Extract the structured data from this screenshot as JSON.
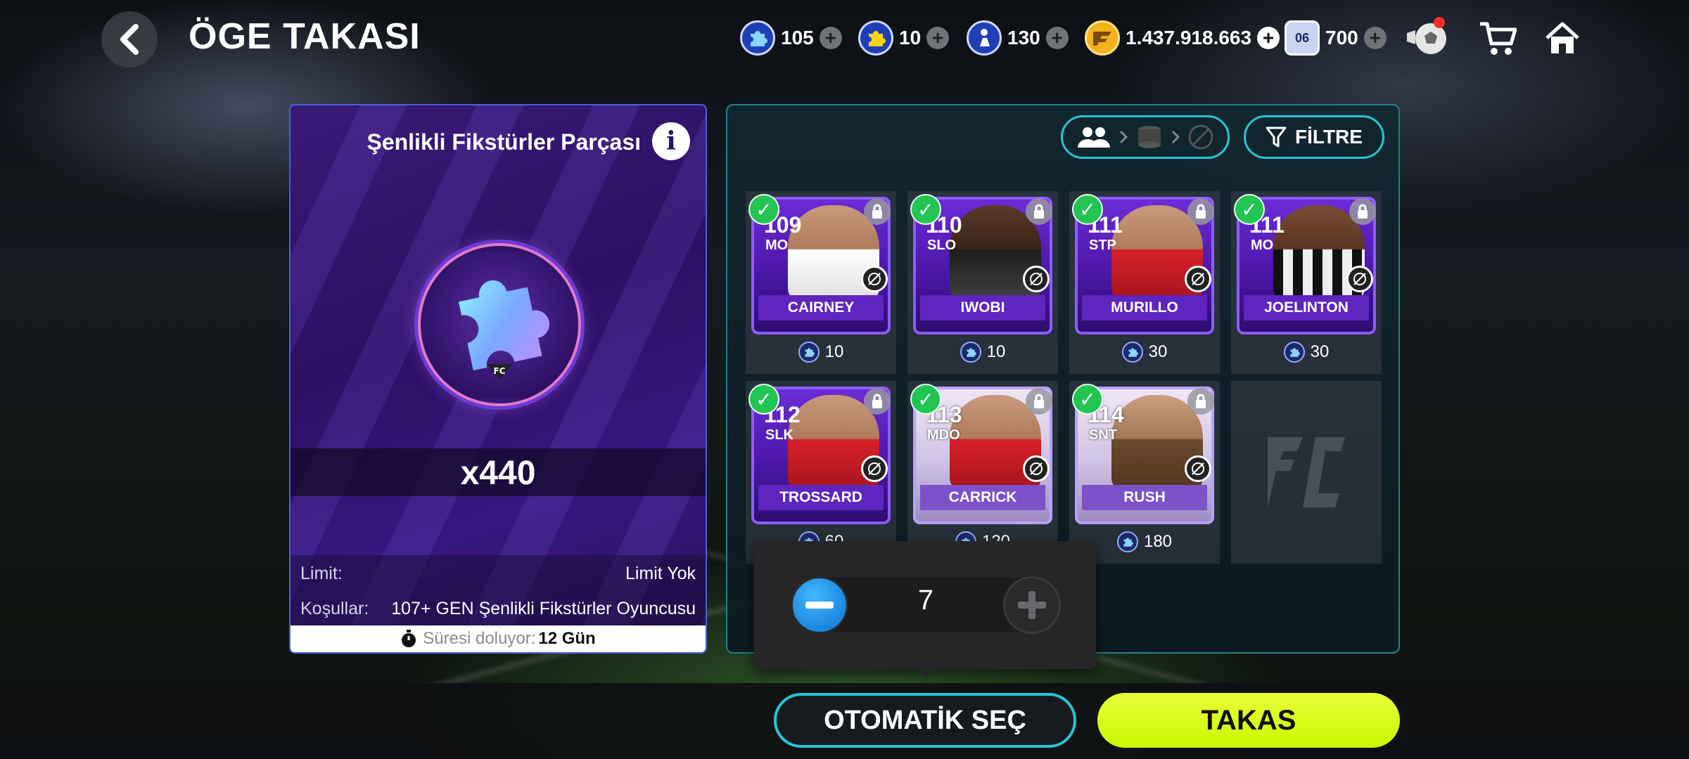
{
  "header": {
    "title": "ÖGE TAKASI",
    "currencies": [
      {
        "icon": "blue-puzzle-icon",
        "value": "105",
        "add": "+"
      },
      {
        "icon": "gold-puzzle-icon",
        "value": "10",
        "add": "+"
      },
      {
        "icon": "player-token-icon",
        "value": "130",
        "add": "+"
      },
      {
        "icon": "fc-coin-icon",
        "value": "1.437.918.663",
        "add": "+"
      },
      {
        "icon": "fc-points-badge-icon",
        "badge": "06",
        "value": "700",
        "add": "+"
      }
    ]
  },
  "item_panel": {
    "title": "Şenlikli Fikstürler Parçası",
    "info_glyph": "i",
    "count": "x440",
    "limit_label": "Limit:",
    "limit_value": "Limit Yok",
    "conditions_label": "Koşullar:",
    "conditions_value": "107+ GEN Şenlikli Fikstürler Oyuncusu",
    "expiry_label": "Süresi doluyor:",
    "expiry_value": "12 Gün"
  },
  "filter": {
    "label": "FİLTRE"
  },
  "players": [
    {
      "rating": "109",
      "position": "MO",
      "name": "CAIRNEY",
      "cost": "10",
      "selected": true
    },
    {
      "rating": "110",
      "position": "SLO",
      "name": "IWOBI",
      "cost": "10",
      "selected": true
    },
    {
      "rating": "111",
      "position": "STP",
      "name": "MURILLO",
      "cost": "30",
      "selected": true
    },
    {
      "rating": "111",
      "position": "MO",
      "name": "JOELINTON",
      "cost": "30",
      "selected": true
    },
    {
      "rating": "112",
      "position": "SLK",
      "name": "TROSSARD",
      "cost": "60",
      "selected": true
    },
    {
      "rating": "113",
      "position": "MDO",
      "name": "CARRICK",
      "cost": "120",
      "selected": true
    },
    {
      "rating": "114",
      "position": "SNT",
      "name": "RUSH",
      "cost": "180",
      "selected": true
    }
  ],
  "stepper": {
    "value": "7",
    "minus": "−",
    "plus": "+"
  },
  "actions": {
    "auto_select": "OTOMATİK SEÇ",
    "swap": "TAKAS"
  }
}
